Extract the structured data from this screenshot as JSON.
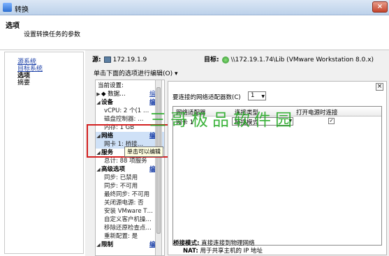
{
  "window": {
    "title": "转换",
    "close_glyph": "×"
  },
  "header": {
    "title": "选项",
    "subtitle": "设置转换任务的参数"
  },
  "nav": {
    "items": [
      {
        "label": "源系统",
        "type": "link"
      },
      {
        "label": "目标系统",
        "type": "link"
      },
      {
        "label": "选项",
        "type": "current"
      },
      {
        "label": "摘要",
        "type": "plain"
      }
    ]
  },
  "source": {
    "label": "源:",
    "value": "172.19.1.9"
  },
  "target": {
    "label": "目标:",
    "value": "\\\\172.19.1.74\\Lib (VMware Workstation 8.0.x)"
  },
  "edit_hint": "单击下面的选项进行编辑(O) ▾",
  "tree": {
    "header": "当前设置:",
    "rows": [
      {
        "text": "◆ 数据…",
        "section": false,
        "arrow": "▶",
        "edit": "编辑"
      },
      {
        "text": "设备",
        "section": true,
        "arrow": "◢",
        "edit": "编辑"
      },
      {
        "text": "vCPU: 2 个(1 …",
        "section": false,
        "arrow": "",
        "edit": ""
      },
      {
        "text": "磁盘控制器: …",
        "section": false,
        "arrow": "",
        "edit": ""
      },
      {
        "text": "内存: 1 GB",
        "section": false,
        "arrow": "",
        "edit": ""
      },
      {
        "text": "网络",
        "section": true,
        "arrow": "◢",
        "edit": "编辑"
      },
      {
        "text": "网卡 1: 桥接…",
        "section": false,
        "arrow": "",
        "edit": ""
      },
      {
        "text": "服务",
        "section": true,
        "arrow": "◢",
        "edit": ""
      },
      {
        "text": "总计: 88 项服务",
        "section": false,
        "arrow": "",
        "edit": ""
      },
      {
        "text": "高级选项",
        "section": true,
        "arrow": "◢",
        "edit": "编辑"
      },
      {
        "text": "同步: 已禁用",
        "section": false,
        "arrow": "",
        "edit": ""
      },
      {
        "text": "同步: 不可用",
        "section": false,
        "arrow": "",
        "edit": ""
      },
      {
        "text": "最终同步: 不可用",
        "section": false,
        "arrow": "",
        "edit": ""
      },
      {
        "text": "关闭源电源: 否",
        "section": false,
        "arrow": "",
        "edit": ""
      },
      {
        "text": "安装 VMware T…",
        "section": false,
        "arrow": "",
        "edit": ""
      },
      {
        "text": "自定义客户机操…",
        "section": false,
        "arrow": "",
        "edit": ""
      },
      {
        "text": "移除还原检查点…",
        "section": false,
        "arrow": "",
        "edit": ""
      },
      {
        "text": "重新配置: 是",
        "section": false,
        "arrow": "",
        "edit": ""
      },
      {
        "text": "限制",
        "section": true,
        "arrow": "◢",
        "edit": "编辑"
      }
    ]
  },
  "tooltip": "单击可以编辑",
  "watermark": "三哥极品软件园",
  "right_panel": {
    "close_glyph": "×",
    "nic_count_label": "要连接的网络适配器数(C)",
    "nic_count_value": "1",
    "columns": [
      "网络适配器",
      "连接类型",
      "打开电源时连接"
    ],
    "rows": [
      {
        "adapter": "网卡 1",
        "type": "桥接模式",
        "connect": "✓"
      }
    ],
    "mode_label": "桥接模式:",
    "mode_desc": "直接连接到物理网络",
    "nat_label": "NAT:",
    "nat_desc": "用于共享主机的 IP 地址"
  }
}
